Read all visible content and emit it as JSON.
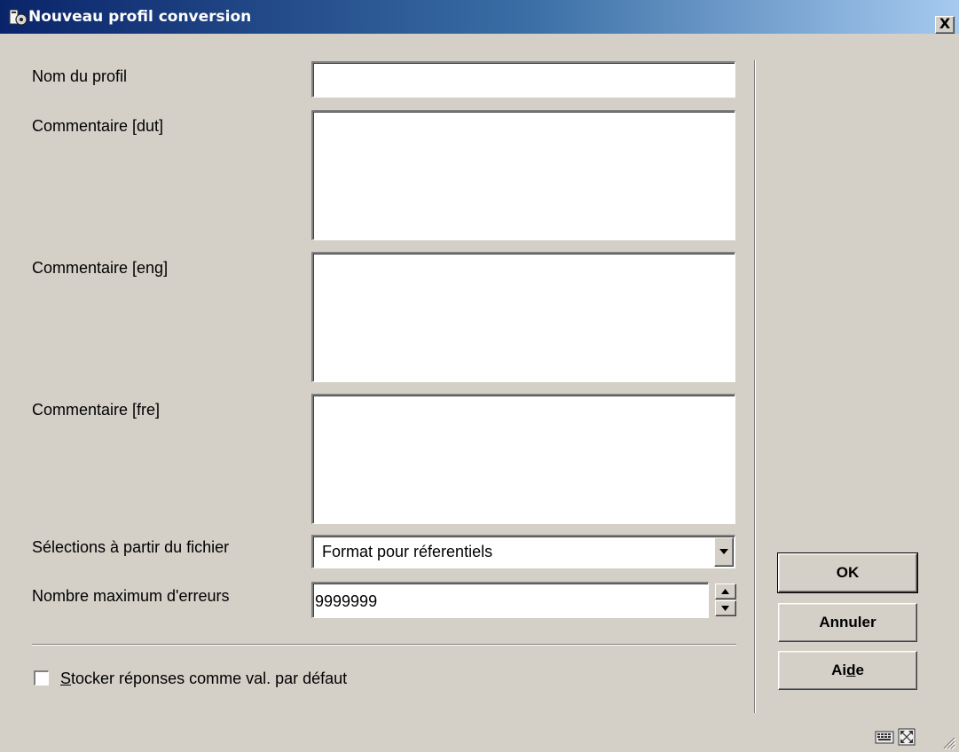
{
  "window": {
    "title": "Nouveau profil conversion",
    "close_icon": "close-icon",
    "close_glyph": "X"
  },
  "form": {
    "profile_name": {
      "label": "Nom du profil",
      "value": ""
    },
    "comment_dut": {
      "label": "Commentaire [dut]",
      "value": ""
    },
    "comment_eng": {
      "label": "Commentaire [eng]",
      "value": ""
    },
    "comment_fre": {
      "label": "Commentaire [fre]",
      "value": ""
    },
    "selection_source": {
      "label": "Sélections à partir du fichier",
      "value": "Format pour réferentiels"
    },
    "max_errors": {
      "label": "Nombre maximum d'erreurs",
      "value": "9999999"
    }
  },
  "checkbox": {
    "checked": false,
    "mnemonic": "S",
    "label_rest": "tocker réponses comme val. par défaut"
  },
  "buttons": {
    "ok": "OK",
    "cancel": "Annuler",
    "help_pre": "Ai",
    "help_mnemonic": "d",
    "help_post": "e"
  },
  "status_icons": [
    "keyboard-icon",
    "maximize-icon",
    "resize-grip-icon"
  ]
}
